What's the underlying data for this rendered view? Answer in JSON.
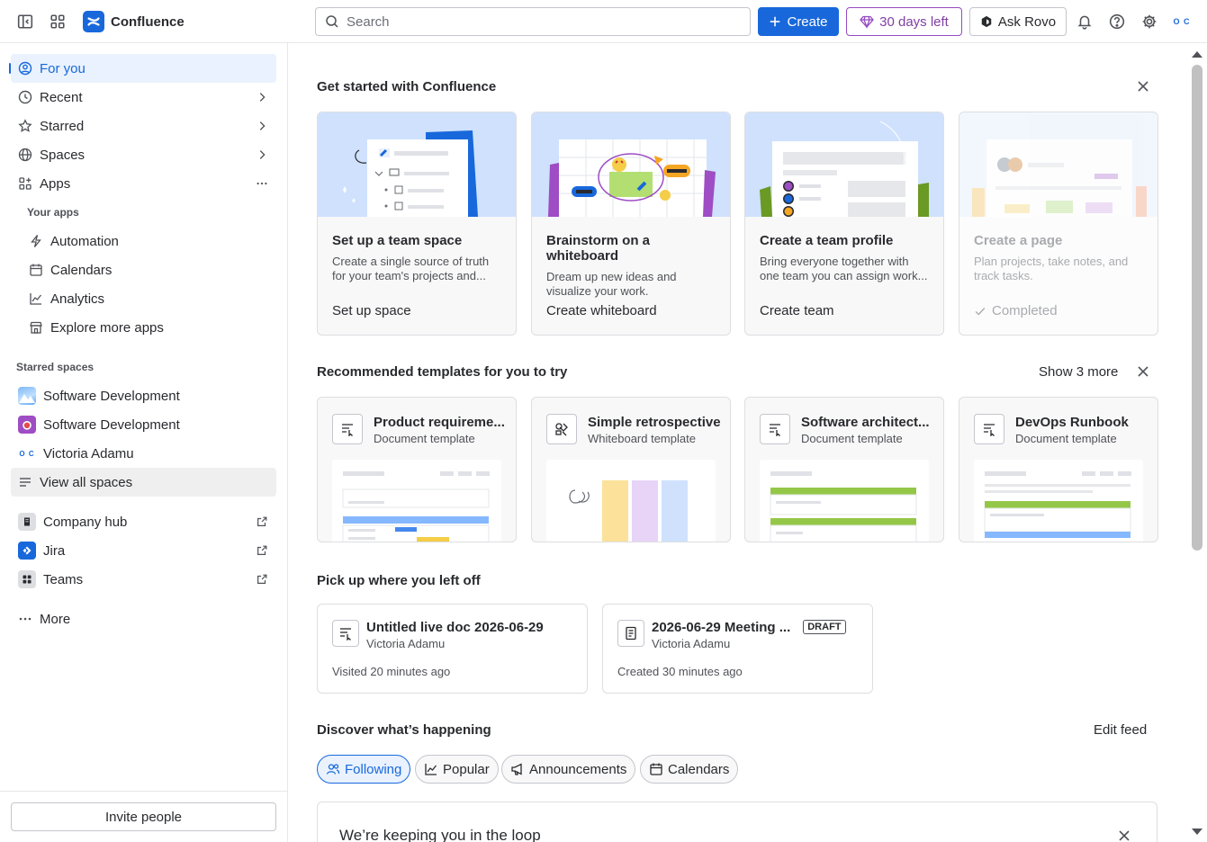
{
  "app": {
    "name": "Confluence"
  },
  "topbar": {
    "search_placeholder": "Search",
    "create_label": "Create",
    "trial_label": "30 days left",
    "rovo_label": "Ask Rovo",
    "avatar_initials": "O C"
  },
  "sidebar": {
    "items": [
      {
        "label": "For you"
      },
      {
        "label": "Recent"
      },
      {
        "label": "Starred"
      },
      {
        "label": "Spaces"
      },
      {
        "label": "Apps"
      }
    ],
    "your_apps_label": "Your apps",
    "apps": [
      {
        "label": "Automation"
      },
      {
        "label": "Calendars"
      },
      {
        "label": "Analytics"
      },
      {
        "label": "Explore more apps"
      }
    ],
    "starred_spaces_label": "Starred spaces",
    "spaces": [
      {
        "label": "Software Development"
      },
      {
        "label": "Software Development"
      },
      {
        "label": "Victoria Adamu",
        "avatar": "O C"
      },
      {
        "label": "View all spaces"
      }
    ],
    "links": [
      {
        "label": "Company hub"
      },
      {
        "label": "Jira"
      },
      {
        "label": "Teams"
      }
    ],
    "more_label": "More",
    "invite_label": "Invite people"
  },
  "get_started": {
    "title": "Get started with Confluence",
    "cards": [
      {
        "title": "Set up a team space",
        "desc": "Create a single source of truth for your team's projects and...",
        "action": "Set up space"
      },
      {
        "title": "Brainstorm on a whiteboard",
        "desc": "Dream up new ideas and visualize your work.",
        "action": "Create whiteboard"
      },
      {
        "title": "Create a team profile",
        "desc": "Bring everyone together with one team you can assign work...",
        "action": "Create team"
      },
      {
        "title": "Create a page",
        "desc": "Plan projects, take notes, and track tasks.",
        "action": "Completed"
      }
    ]
  },
  "templates": {
    "title": "Recommended templates for you to try",
    "show_more": "Show 3 more",
    "cards": [
      {
        "name": "Product requireme...",
        "type": "Document template"
      },
      {
        "name": "Simple retrospective",
        "type": "Whiteboard template"
      },
      {
        "name": "Software architect...",
        "type": "Document template"
      },
      {
        "name": "DevOps Runbook",
        "type": "Document template"
      }
    ]
  },
  "pickup": {
    "title": "Pick up where you left off",
    "items": [
      {
        "title": "Untitled live doc 2026-06-29",
        "author": "Victoria Adamu",
        "meta": "Visited 20 minutes ago"
      },
      {
        "title": "2026-06-29 Meeting ...",
        "badge": "DRAFT",
        "author": "Victoria Adamu",
        "meta": "Created 30 minutes ago"
      }
    ]
  },
  "discover": {
    "title": "Discover what’s happening",
    "edit_feed": "Edit feed",
    "tabs": [
      {
        "label": "Following",
        "selected": true
      },
      {
        "label": "Popular"
      },
      {
        "label": "Announcements"
      },
      {
        "label": "Calendars"
      }
    ],
    "banner_title": "We’re keeping you in the loop"
  },
  "colors": {
    "brand": "#1868db",
    "selected_bg": "#e9f2fe",
    "trial": "#803fa5"
  }
}
